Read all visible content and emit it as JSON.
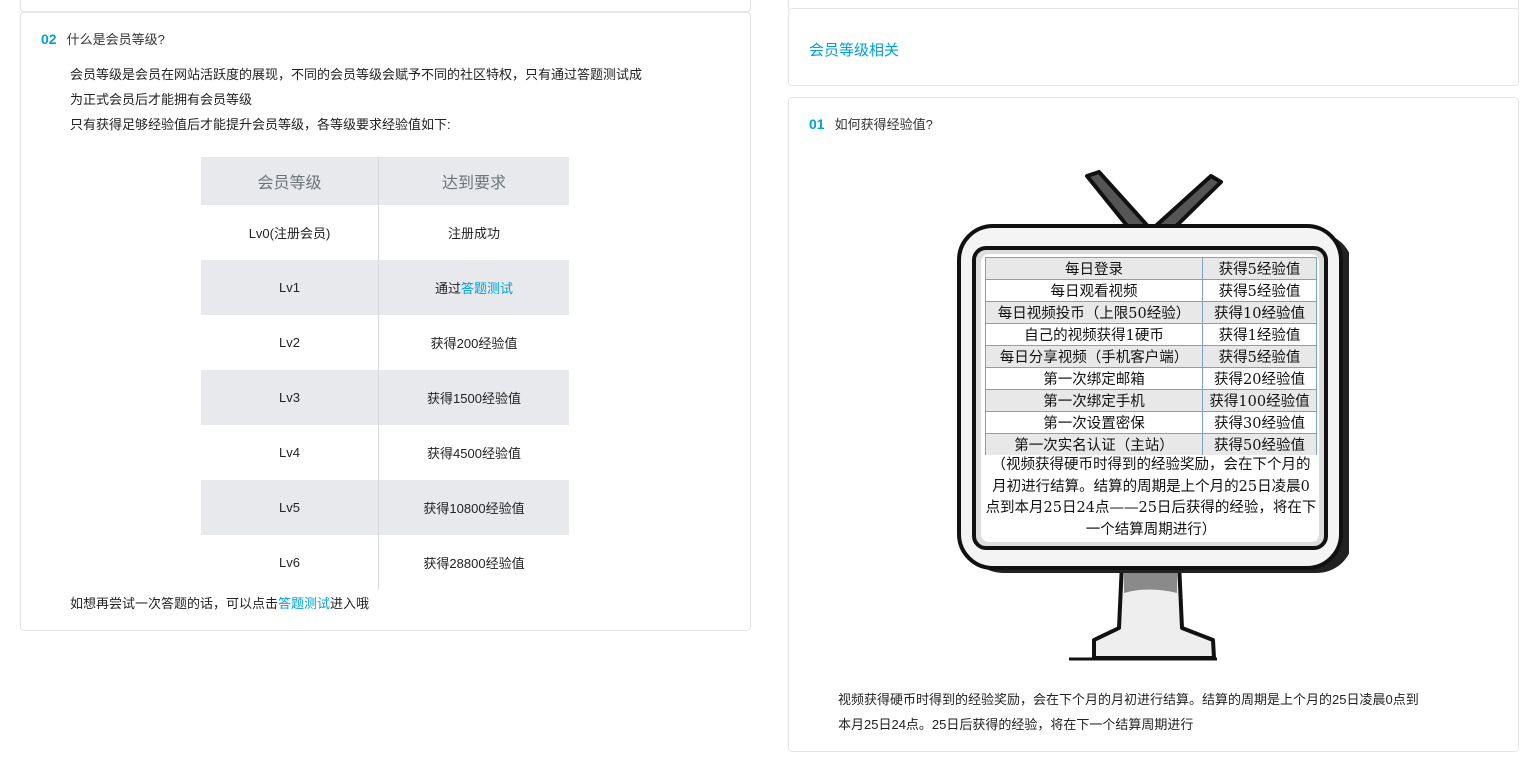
{
  "left": {
    "section_num": "02",
    "section_title": "什么是会员等级?",
    "intro_line1": "会员等级是会员在网站活跃度的展现，不同的会员等级会赋予不同的社区特权，只有通过答题测试成",
    "intro_line2": "为正式会员后才能拥有会员等级",
    "intro_line3": "只有获得足够经验值后才能提升会员等级，各等级要求经验值如下:",
    "table_headers": [
      "会员等级",
      "达到要求"
    ],
    "rows": [
      {
        "level": "Lv0(注册会员)",
        "req": "注册成功"
      },
      {
        "level": "Lv1",
        "req_prefix": "通过",
        "req_link": "答题测试"
      },
      {
        "level": "Lv2",
        "req": "获得200经验值"
      },
      {
        "level": "Lv3",
        "req": "获得1500经验值"
      },
      {
        "level": "Lv4",
        "req": "获得4500经验值"
      },
      {
        "level": "Lv5",
        "req": "获得10800经验值"
      },
      {
        "level": "Lv6",
        "req": "获得28800经验值"
      }
    ],
    "retry_prefix": "如想再尝试一次答题的话，可以点击",
    "retry_link": "答题测试",
    "retry_suffix": "进入哦"
  },
  "right": {
    "heading": "会员等级相关",
    "section_num": "01",
    "section_title": "如何获得经验值?",
    "tv_rows": [
      [
        "每日登录",
        "获得5经验值"
      ],
      [
        "每日观看视频",
        "获得5经验值"
      ],
      [
        "每日视频投币（上限50经验）",
        "获得10经验值"
      ],
      [
        "自己的视频获得1硬币",
        "获得1经验值"
      ],
      [
        "每日分享视频（手机客户端）",
        "获得5经验值"
      ],
      [
        "第一次绑定邮箱",
        "获得20经验值"
      ],
      [
        "第一次绑定手机",
        "获得100经验值"
      ],
      [
        "第一次设置密保",
        "获得30经验值"
      ],
      [
        "第一次实名认证（主站）",
        "获得50经验值"
      ]
    ],
    "tv_note": "（视频获得硬币时得到的经验奖励，会在下个月的月初进行结算。结算的周期是上个月的25日凌晨0点到本月25日24点——25日后获得的经验，将在下一个结算周期进行）",
    "footer_line1": "视频获得硬币时得到的经验奖励，会在下个月的月初进行结算。结算的周期是上个月的25日凌晨0点到",
    "footer_line2": "本月25日24点。25日后获得的经验，将在下一个结算周期进行"
  }
}
